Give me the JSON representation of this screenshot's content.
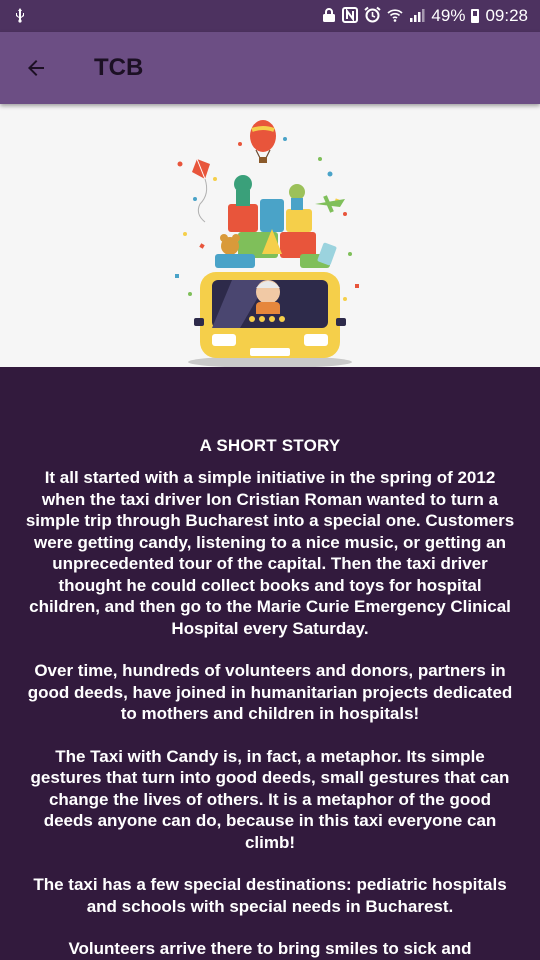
{
  "status_bar": {
    "battery_percent": "49%",
    "time": "09:28"
  },
  "app_bar": {
    "title": "TCB"
  },
  "story": {
    "heading": "A SHORT STORY",
    "paragraphs": [
      "It all started with a simple initiative in the spring of 2012 when the taxi driver Ion Cristian Roman wanted to turn a simple trip through Bucharest into a special one. Customers were getting candy, listening to a nice music, or getting an unprecedented tour of the capital. Then the taxi driver thought he could collect books and toys for hospital children, and then go to the Marie Curie Emergency Clinical Hospital every Saturday.",
      "Over time, hundreds of volunteers and donors, partners in good deeds, have joined in humanitarian projects dedicated to mothers and children in hospitals!",
      "The Taxi with Candy is, in fact, a metaphor. Its simple gestures that turn into good deeds, small gestures that can change the lives of others. It is a metaphor of the good deeds anyone can do, because in this taxi everyone can climb!",
      "The taxi has a few special destinations: pediatric hospitals and schools with special needs in Bucharest.",
      "Volunteers arrive there to bring smiles to sick and"
    ]
  },
  "colors": {
    "status_bar": "#4d3260",
    "app_bar": "#6c4e84",
    "background": "#321a3d",
    "hero_background": "#f6f6f6",
    "taxi_yellow": "#f5cf4a"
  }
}
